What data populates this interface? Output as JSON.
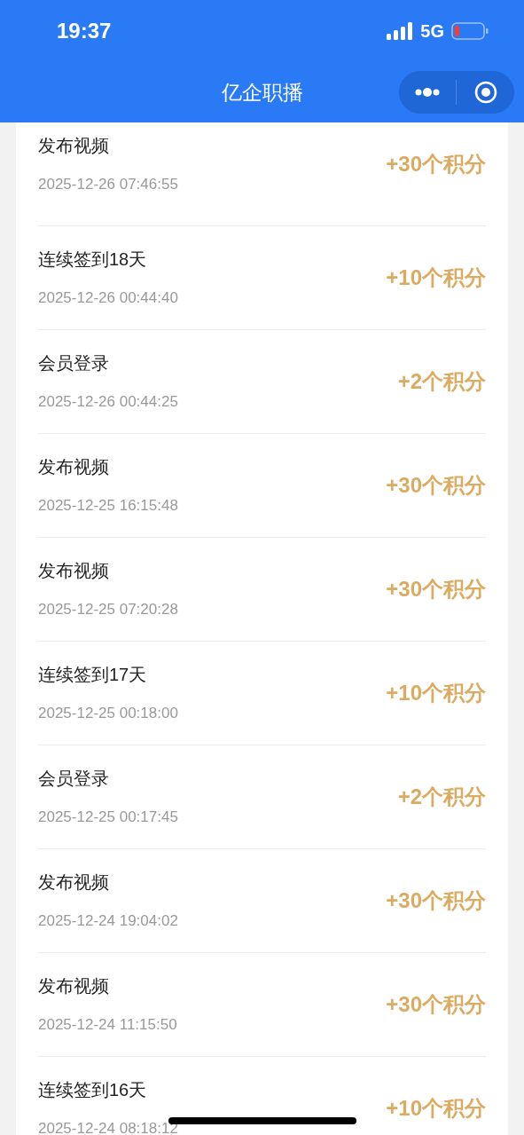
{
  "status_bar": {
    "time": "19:37",
    "network": "5G"
  },
  "nav": {
    "title": "亿企职播"
  },
  "records": [
    {
      "title": "发布视频",
      "time": "2025-12-26 07:46:55",
      "points": "+30个积分"
    },
    {
      "title": "连续签到18天",
      "time": "2025-12-26 00:44:40",
      "points": "+10个积分"
    },
    {
      "title": "会员登录",
      "time": "2025-12-26 00:44:25",
      "points": "+2个积分"
    },
    {
      "title": "发布视频",
      "time": "2025-12-25 16:15:48",
      "points": "+30个积分"
    },
    {
      "title": "发布视频",
      "time": "2025-12-25 07:20:28",
      "points": "+30个积分"
    },
    {
      "title": "连续签到17天",
      "time": "2025-12-25 00:18:00",
      "points": "+10个积分"
    },
    {
      "title": "会员登录",
      "time": "2025-12-25 00:17:45",
      "points": "+2个积分"
    },
    {
      "title": "发布视频",
      "time": "2025-12-24 19:04:02",
      "points": "+30个积分"
    },
    {
      "title": "发布视频",
      "time": "2025-12-24 11:15:50",
      "points": "+30个积分"
    },
    {
      "title": "连续签到16天",
      "time": "2025-12-24 08:18:12",
      "points": "+10个积分"
    }
  ]
}
